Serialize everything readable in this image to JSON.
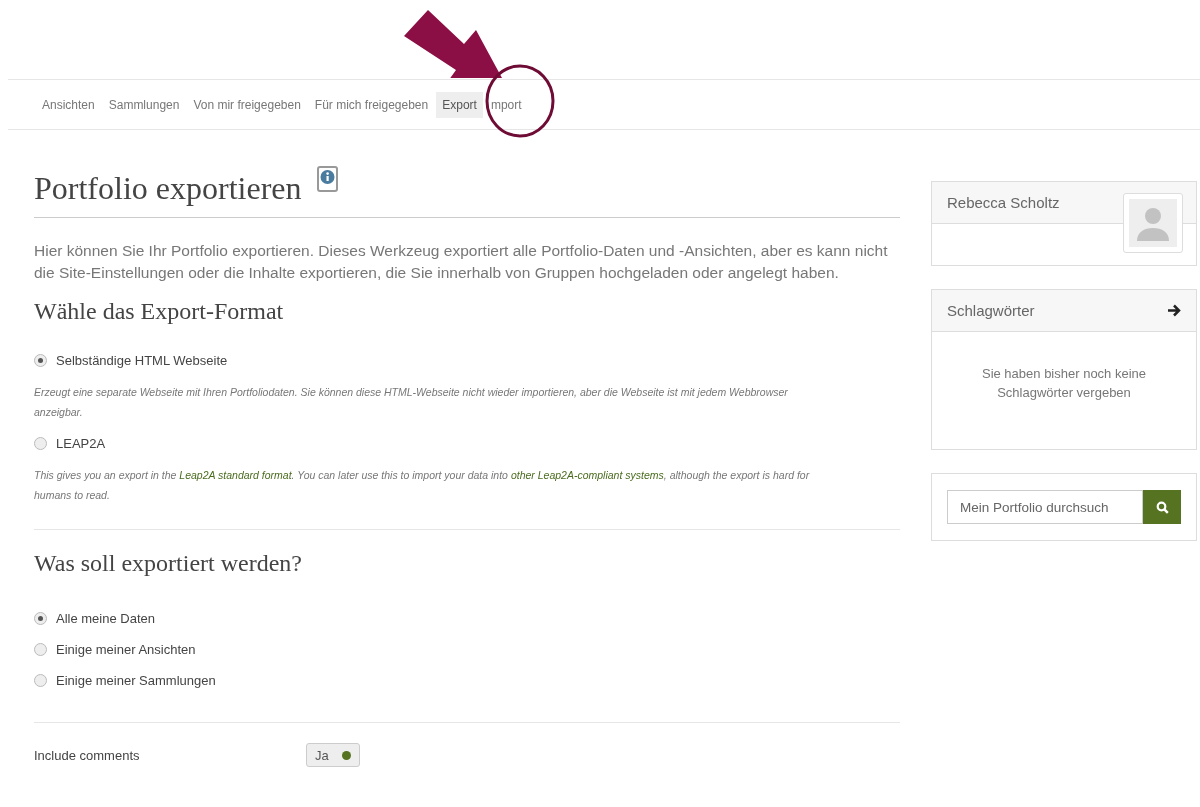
{
  "nav": {
    "tabs": [
      {
        "label": "Ansichten",
        "selected": false
      },
      {
        "label": "Sammlungen",
        "selected": false
      },
      {
        "label": "Von mir freigegeben",
        "selected": false
      },
      {
        "label": "Für mich freigegeben",
        "selected": false
      },
      {
        "label": "Export",
        "selected": true
      },
      {
        "label": "mport",
        "selected": false
      }
    ]
  },
  "title": "Portfolio exportieren",
  "intro": "Hier können Sie Ihr Portfolio exportieren. Dieses Werkzeug exportiert alle Portfolio-Daten und -Ansichten, aber es kann nicht die Site-Einstellungen oder die Inhalte exportieren, die Sie innerhalb von Gruppen hochgeladen oder angelegt haben.",
  "format_heading": "Wähle das Export-Format",
  "formats": [
    {
      "label": "Selbständige HTML Webseite",
      "selected": true,
      "description": [
        {
          "kind": "text",
          "text": "Erzeugt eine separate Webseite mit Ihren Portfoliodaten. Sie können diese HTML-Webseite nicht wieder importieren, aber die Webseite ist mit jedem Webbrowser anzeigbar."
        }
      ]
    },
    {
      "label": "LEAP2A",
      "selected": false,
      "description": [
        {
          "kind": "text",
          "text": "This gives you an export in the"
        },
        {
          "kind": "link",
          "text": "Leap2A standard format"
        },
        {
          "kind": "text",
          "text": ". You can later use this to import your data into"
        },
        {
          "kind": "link",
          "text": "other Leap2A-compliant systems"
        },
        {
          "kind": "text",
          "text": ", although the export is hard for humans to read."
        }
      ]
    }
  ],
  "what_heading": "Was soll exportiert werden?",
  "what_options": [
    {
      "label": "Alle meine Daten",
      "selected": true
    },
    {
      "label": "Einige meiner Ansichten",
      "selected": false
    },
    {
      "label": "Einige meiner Sammlungen",
      "selected": false
    }
  ],
  "include_comments": {
    "label": "Include comments",
    "value": "Ja",
    "on": true
  },
  "sidebar": {
    "user": {
      "name": "Rebecca Scholtz"
    },
    "tags": {
      "title": "Schlagwörter",
      "empty": "Sie haben bisher noch keine Schlagwörter vergeben"
    },
    "search": {
      "placeholder": "Mein Portfolio durchsuch"
    }
  }
}
